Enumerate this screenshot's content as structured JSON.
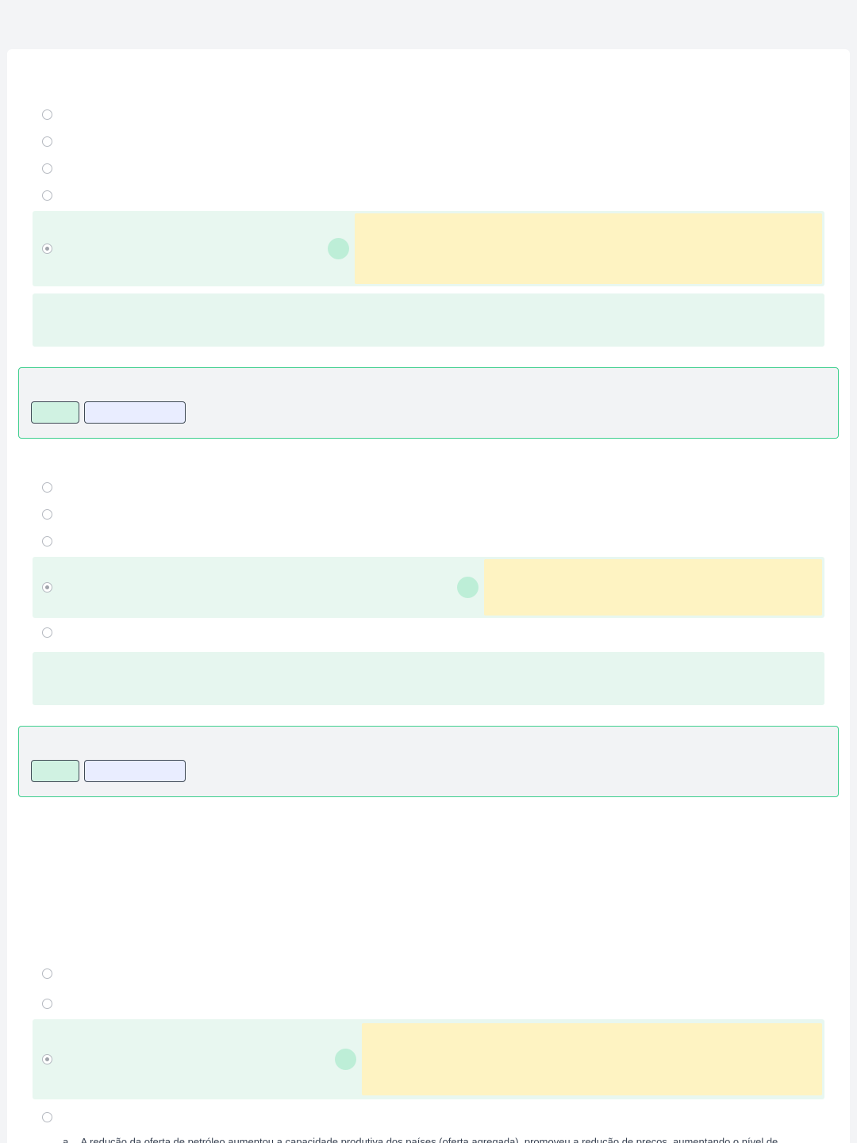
{
  "questions": [
    {
      "options_count": 5,
      "selected_option": 5,
      "feedback": {
        "primary_label": "",
        "secondary_label": ""
      }
    },
    {
      "options_count": 5,
      "selected_option": 4,
      "feedback": {
        "primary_label": "",
        "secondary_label": ""
      }
    },
    {
      "options_count": 4,
      "selected_option": 3
    }
  ],
  "bottom_option": {
    "marker": "a.",
    "text": "A redução da oferta de petróleo aumentou a capacidade produtiva dos países (oferta agregada), promoveu a redução de preços, aumentando o nível de"
  },
  "colors": {
    "background": "#f3f4f6",
    "selected_row": "#e8f7f0",
    "highlight": "#fef3c2",
    "correct_dot": "#bdeed7",
    "feedback_border": "#3ecf8e",
    "primary_button": "#d0f2e2",
    "secondary_button": "#e9edff"
  }
}
